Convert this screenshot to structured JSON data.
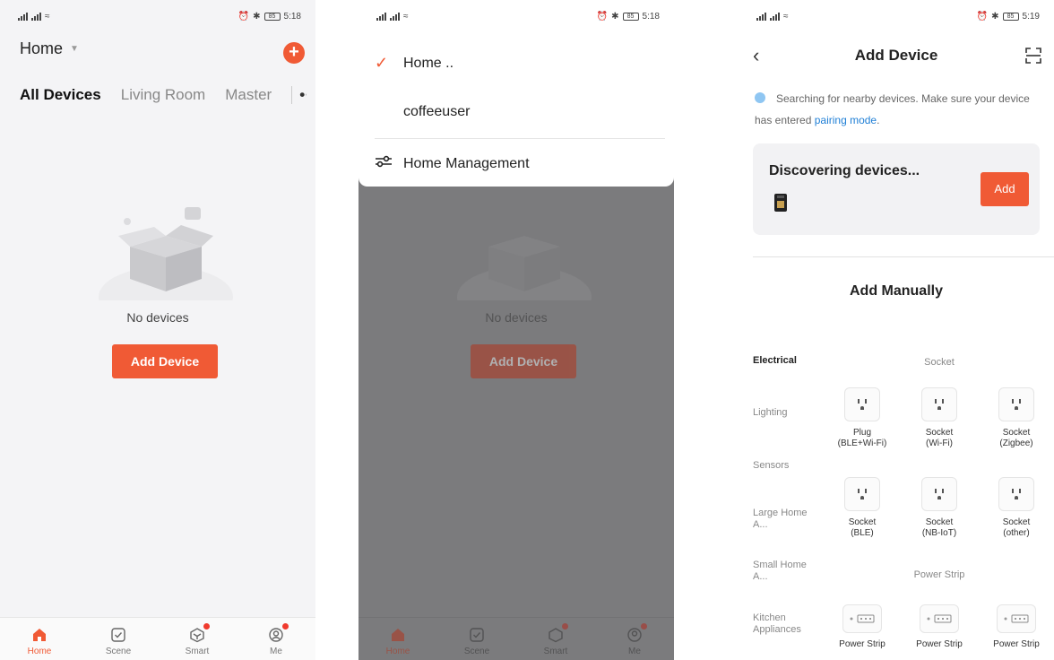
{
  "status": {
    "time_1": "5:18",
    "time_2": "5:18",
    "time_3": "5:19",
    "battery": "85"
  },
  "home_screen": {
    "home_label": "Home",
    "tabs": [
      "All Devices",
      "Living Room",
      "Master"
    ],
    "more_label": "•••",
    "empty_text": "No devices",
    "add_device_label": "Add Device"
  },
  "bottom_nav": [
    {
      "label": "Home",
      "icon": "home-icon",
      "active": true
    },
    {
      "label": "Scene",
      "icon": "scene-check-icon",
      "active": false
    },
    {
      "label": "Smart",
      "icon": "smart-cube-icon",
      "active": false,
      "badge": true
    },
    {
      "label": "Me",
      "icon": "profile-icon",
      "active": false,
      "badge": true
    }
  ],
  "home_menu": {
    "current_home": "Home ..",
    "other_home": "coffeeuser",
    "management_label": "Home Management"
  },
  "add_device_screen": {
    "title": "Add Device",
    "search_text": "Searching for nearby devices. Make sure your device has entered ",
    "pairing_link": "pairing mode",
    "search_suffix": ".",
    "discovering_label": "Discovering devices...",
    "add_label": "Add",
    "manual_title": "Add Manually",
    "categories": [
      "Electrical",
      "Lighting",
      "Sensors",
      "Large Home A...",
      "Small Home A...",
      "Kitchen Appliances"
    ],
    "section_socket": "Socket",
    "section_power_strip": "Power Strip",
    "devices": [
      "Plug\n(BLE+Wi-Fi)",
      "Socket\n(Wi-Fi)",
      "Socket\n(Zigbee)",
      "Socket\n(BLE)",
      "Socket\n(NB-IoT)",
      "Socket\n(other)",
      "Power Strip",
      "Power Strip",
      "Power Strip"
    ]
  },
  "colors": {
    "accent": "#f05a35",
    "link": "#1f7fd6",
    "badge": "#f03a2d"
  }
}
